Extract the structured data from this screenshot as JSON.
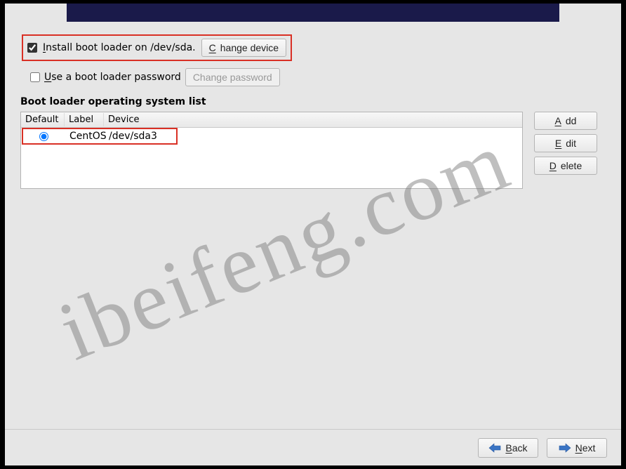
{
  "install_row": {
    "checked": true,
    "label_pre": "I",
    "label_rest": "nstall boot loader on /dev/sda.",
    "change_device_pre": "C",
    "change_device_rest": "hange device"
  },
  "password_row": {
    "checked": false,
    "label_pre": "U",
    "label_rest": "se a boot loader password",
    "change_pw_label": "Change password"
  },
  "os_list": {
    "title": "Boot loader operating system list",
    "headers": {
      "default": "Default",
      "label": "Label",
      "device": "Device"
    },
    "rows": [
      {
        "selected": true,
        "label": "CentOS",
        "device": "/dev/sda3"
      }
    ]
  },
  "side_buttons": {
    "add_pre": "A",
    "add_rest": "dd",
    "edit_pre": "E",
    "edit_rest": "dit",
    "delete_pre": "D",
    "delete_rest": "elete"
  },
  "footer": {
    "back_pre": "B",
    "back_rest": "ack",
    "next_pre": "N",
    "next_rest": "ext"
  },
  "watermark": "ibeifeng.com"
}
